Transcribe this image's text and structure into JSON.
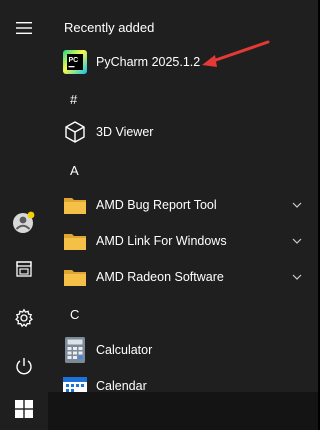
{
  "colors": {
    "menu_bg": "#1f1f1f",
    "folder": "#f4c047",
    "annotation": "#e53935",
    "avatar_dot": "#f5d000"
  },
  "rail": {
    "items": [
      {
        "icon": "hamburger-menu-icon"
      },
      {
        "icon": "user-avatar-icon"
      },
      {
        "icon": "documents-icon"
      },
      {
        "icon": "settings-gear-icon"
      },
      {
        "icon": "power-icon"
      }
    ]
  },
  "sections": {
    "recently_added": "Recently added",
    "hash": "#",
    "a": "A",
    "c": "C"
  },
  "apps": {
    "pycharm": {
      "label": "PyCharm 2025.1.2",
      "icon": "pycharm-icon",
      "icon_text": "PC"
    },
    "viewer3d": {
      "label": "3D Viewer",
      "icon": "3d-cube-icon"
    },
    "amd_bug": {
      "label": "AMD Bug Report Tool",
      "icon": "folder-icon"
    },
    "amd_link": {
      "label": "AMD Link For Windows",
      "icon": "folder-icon"
    },
    "amd_radeon": {
      "label": "AMD Radeon Software",
      "icon": "folder-icon"
    },
    "calculator": {
      "label": "Calculator",
      "icon": "calculator-icon"
    },
    "calendar": {
      "label": "Calendar",
      "icon": "calendar-icon"
    }
  },
  "taskbar": {
    "start_icon": "windows-logo-icon"
  }
}
